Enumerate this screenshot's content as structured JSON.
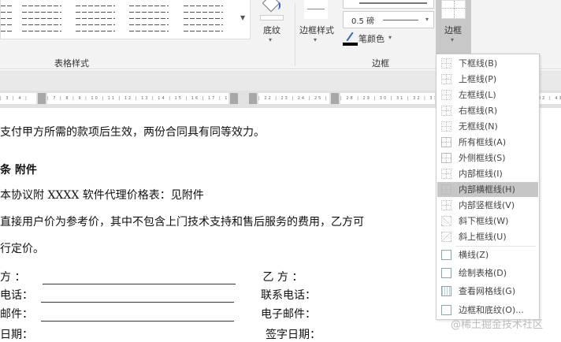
{
  "ribbon": {
    "shading_label": "底纹",
    "border_styles_label": "边框样式",
    "pen_weight": "0.5 磅",
    "pen_color_label": "笔颜色",
    "borders_label": "边框",
    "group_table_styles": "表格样式",
    "group_borders": "边框"
  },
  "document": {
    "lines": [
      "支付甲方所需的款项后生效，两份合同具有同等效力。",
      "条 附件",
      "本协议附 XXXX 软件代理价格表：见附件",
      "直接用户价为参考价，其中不包含上门技术支持和售后服务的费用，乙方可",
      "行定价。"
    ],
    "form": [
      {
        "left": "方 ：",
        "right": "乙 方 ："
      },
      {
        "left": "电话：",
        "right": "联系电话："
      },
      {
        "left": "邮件：",
        "right": "电子邮件："
      },
      {
        "left": "日期：",
        "right": "签字日期："
      }
    ]
  },
  "border_menu": {
    "items": [
      {
        "label": "下框线(B)",
        "icon": "bottom-border-icon"
      },
      {
        "label": "上框线(P)",
        "icon": "top-border-icon"
      },
      {
        "label": "左框线(L)",
        "icon": "left-border-icon"
      },
      {
        "label": "右框线(R)",
        "icon": "right-border-icon"
      },
      {
        "label": "无框线(N)",
        "icon": "no-border-icon"
      },
      {
        "label": "所有框线(A)",
        "icon": "all-borders-icon"
      },
      {
        "label": "外侧框线(S)",
        "icon": "outside-borders-icon"
      },
      {
        "label": "内部框线(I)",
        "icon": "inside-borders-icon"
      },
      {
        "label": "内部横框线(H)",
        "icon": "inside-horizontal-border-icon"
      },
      {
        "label": "内部竖框线(V)",
        "icon": "inside-vertical-border-icon"
      },
      {
        "label": "斜下框线(W)",
        "icon": "diagonal-down-border-icon"
      },
      {
        "label": "斜上框线(U)",
        "icon": "diagonal-up-border-icon"
      },
      {
        "label": "横线(Z)",
        "icon": "horizontal-line-icon"
      },
      {
        "label": "绘制表格(D)",
        "icon": "draw-table-icon"
      },
      {
        "label": "查看网格线(G)",
        "icon": "view-gridlines-icon"
      },
      {
        "label": "边框和底纹(O)...",
        "icon": "borders-shading-icon"
      }
    ],
    "highlighted_index": 8
  },
  "watermark": "@稀土掘金技术社区"
}
